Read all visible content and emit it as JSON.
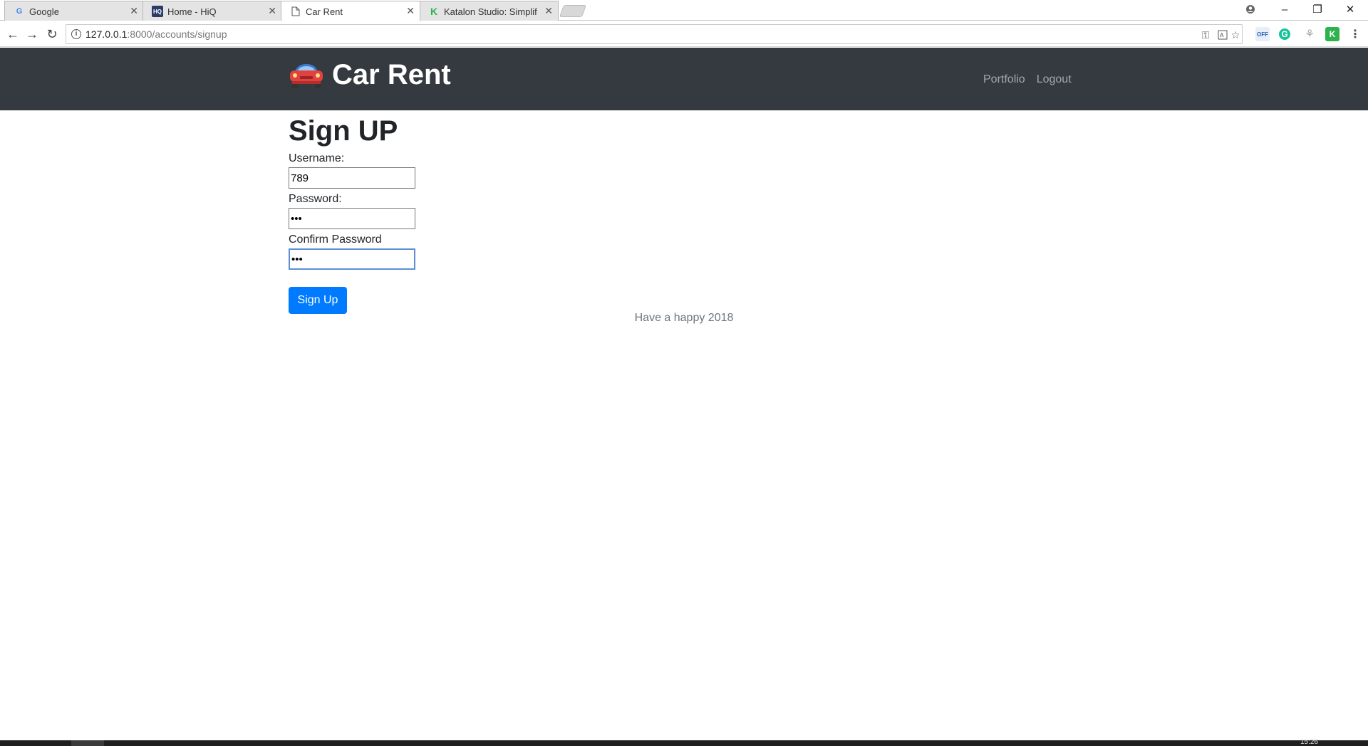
{
  "browser": {
    "tabs": [
      {
        "title": "Google",
        "icon": "google-favicon",
        "active": false
      },
      {
        "title": "Home - HiQ",
        "icon": "hiq-favicon",
        "active": false
      },
      {
        "title": "Car Rent",
        "icon": "page-favicon",
        "active": true
      },
      {
        "title": "Katalon Studio: Simplif",
        "icon": "katalon-favicon",
        "active": false
      }
    ],
    "url_host": "127.0.0.1",
    "url_path": ":8000/accounts/signup",
    "extensions": [
      "key-icon",
      "translate-icon",
      "star-icon",
      "off-extension-icon",
      "grammarly-icon",
      "puzzle-icon",
      "katalon-icon",
      "menu-icon"
    ]
  },
  "navbar": {
    "brand": "Car Rent",
    "links": [
      "Portfolio",
      "Logout"
    ]
  },
  "form": {
    "title": "Sign UP",
    "username_label": "Username:",
    "username_value": "789",
    "password_label": "Password:",
    "password_value": "•••",
    "confirm_label": "Confirm Password",
    "confirm_value": "•••",
    "submit_label": "Sign Up"
  },
  "footer": {
    "text": "Have a happy 2018"
  },
  "taskbar": {
    "clock": "15:26"
  },
  "colors": {
    "navbar_bg": "#343a40",
    "primary": "#007bff",
    "muted": "#6c757d"
  }
}
